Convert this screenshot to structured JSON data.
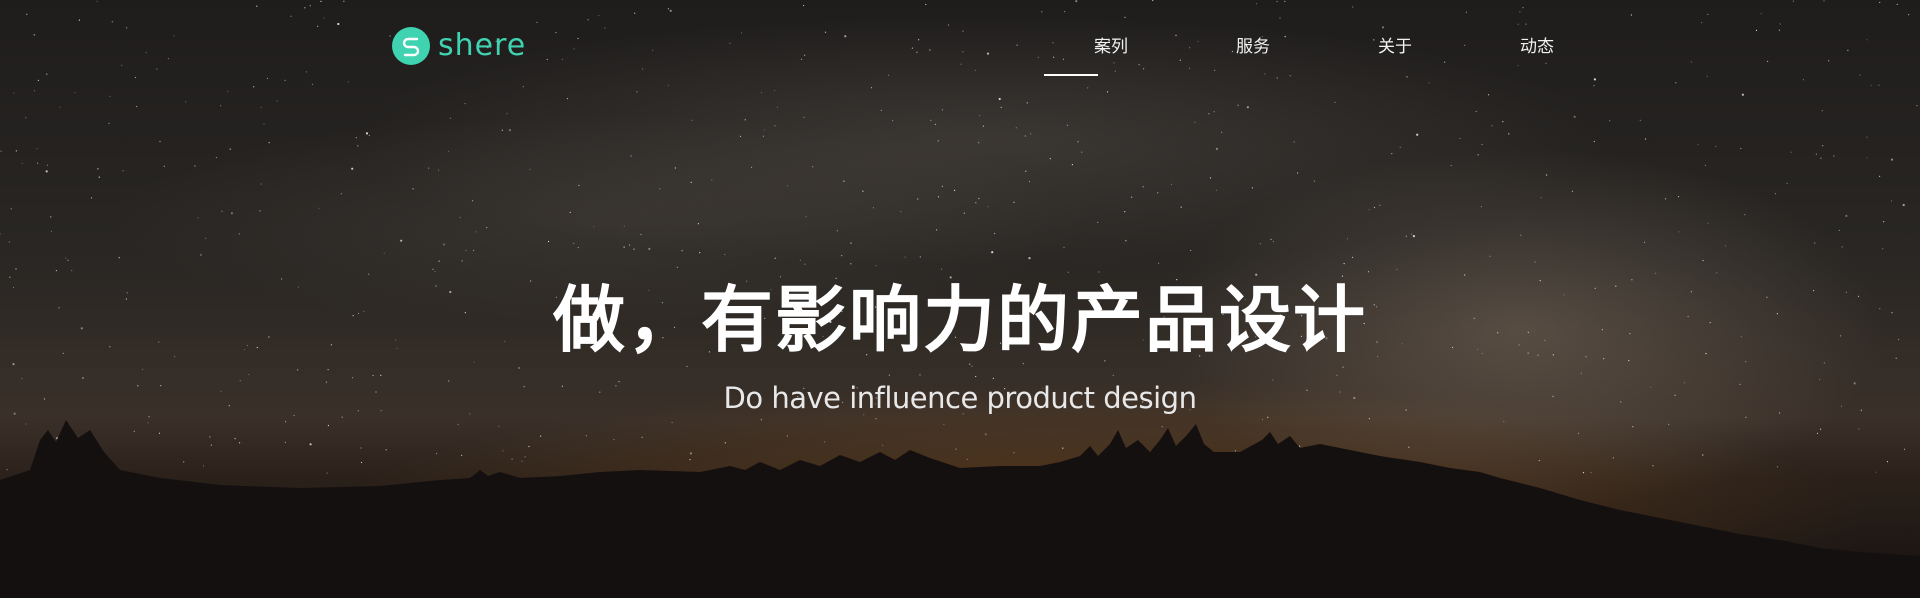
{
  "header": {
    "logo_text": "SHERE",
    "brand_color": "#3fd3b1",
    "nav": [
      {
        "label": "案列",
        "active": true
      },
      {
        "label": "服务",
        "active": false
      },
      {
        "label": "关于",
        "active": false
      },
      {
        "label": "动态",
        "active": false
      }
    ]
  },
  "hero": {
    "title": "做，有影响力的产品设计",
    "subtitle": "Do have influence product design",
    "background": "night-sky-milky-way-treeline"
  }
}
